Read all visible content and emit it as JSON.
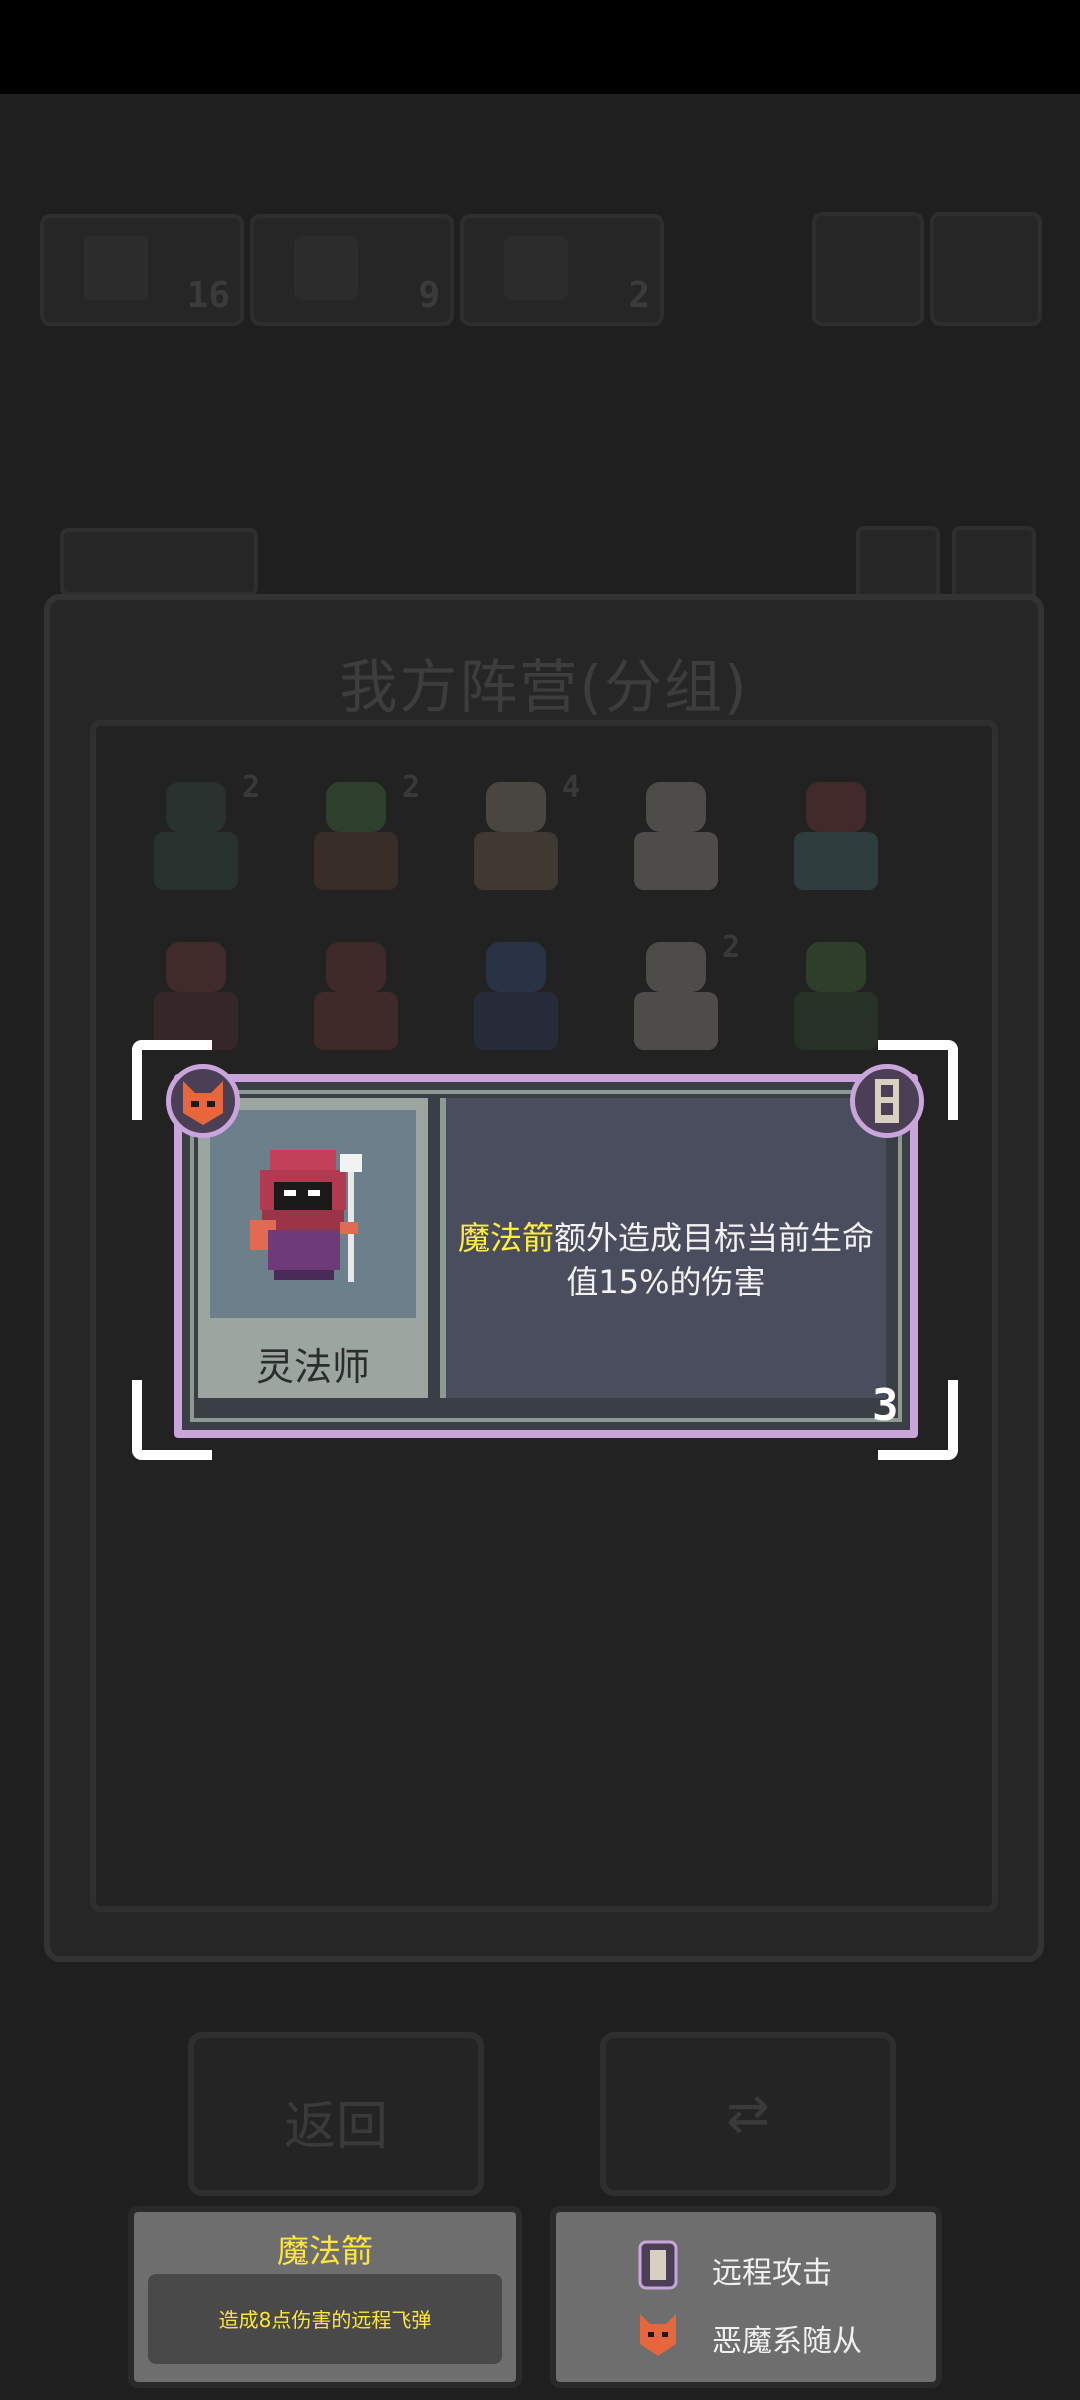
{
  "resources": [
    {
      "value": "16"
    },
    {
      "value": "9"
    },
    {
      "value": "2"
    }
  ],
  "panel": {
    "title": "我方阵营(分组)"
  },
  "units": [
    {
      "count": "2",
      "color": "#4b8b6b"
    },
    {
      "count": "2",
      "color": "#5aa55a"
    },
    {
      "count": "4",
      "color": "#d2c8b0"
    },
    {
      "count": "",
      "color": "#e6e0d2"
    },
    {
      "count": "",
      "color": "#b84a4a"
    },
    {
      "count": "",
      "color": "#b14a4a"
    },
    {
      "count": "",
      "color": "#a84646"
    },
    {
      "count": "",
      "color": "#4a6ac0"
    },
    {
      "count": "2",
      "color": "#e8e2d2"
    },
    {
      "count": "",
      "color": "#5aa04a"
    }
  ],
  "bottom_buttons": {
    "back_label": "返回"
  },
  "card": {
    "name": "灵法师",
    "description_highlight": "魔法箭",
    "description_rest": "额外造成目标当前生命值15%的伤害",
    "level": "3"
  },
  "skill_info": {
    "title": "魔法箭",
    "description": "造成8点伤害的远程飞弹"
  },
  "traits": [
    {
      "icon": "ranged-attack-icon",
      "label": "远程攻击"
    },
    {
      "icon": "demon-fox-icon",
      "label": "恶魔系随从"
    }
  ],
  "colors": {
    "card_border": "#caa5dc",
    "highlight": "#ffef3a",
    "info_title": "#ffe53b"
  }
}
